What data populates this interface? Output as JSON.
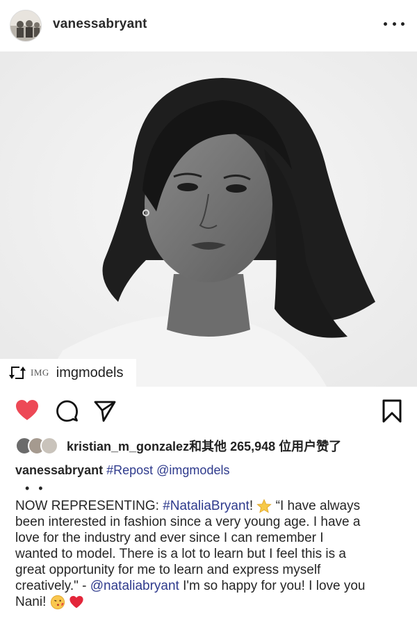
{
  "post": {
    "username": "vanessabryant",
    "more_icon": "more-horizontal-icon"
  },
  "repost": {
    "logo_text": "IMG",
    "account": "imgmodels"
  },
  "actions": {
    "like_icon": "heart-filled-icon",
    "comment_icon": "comment-icon",
    "share_icon": "paper-plane-icon",
    "save_icon": "bookmark-icon",
    "like_color": "#ed4956"
  },
  "likes": {
    "text": "kristian_m_gonzalez和其他 265,948 位用户赞了"
  },
  "caption": {
    "username": "vanessabryant",
    "tag": "#Repost",
    "mention": "@imgmodels",
    "dots": "• •",
    "lines": {
      "l1_a": "NOW REPRESENTING: ",
      "l1_hashtag": "#NataliaBryant",
      "l1_b": "! ",
      "l1_c": " “I have always",
      "l2": "been interested in fashion since a very young age. I have a",
      "l3": "love for the industry and ever since I can remember I",
      "l4": "wanted to model. There is a lot to learn but I feel this is a",
      "l5": "great opportunity for me to learn and express myself",
      "l6_a": "creatively.\" - ",
      "l6_mention": "@nataliabryant",
      "l6_b": " I'm so happy for you! I love you",
      "l7": "Nani! "
    },
    "emojis": [
      "star-emoji",
      "kissing-face-emoji",
      "red-heart-emoji"
    ]
  }
}
